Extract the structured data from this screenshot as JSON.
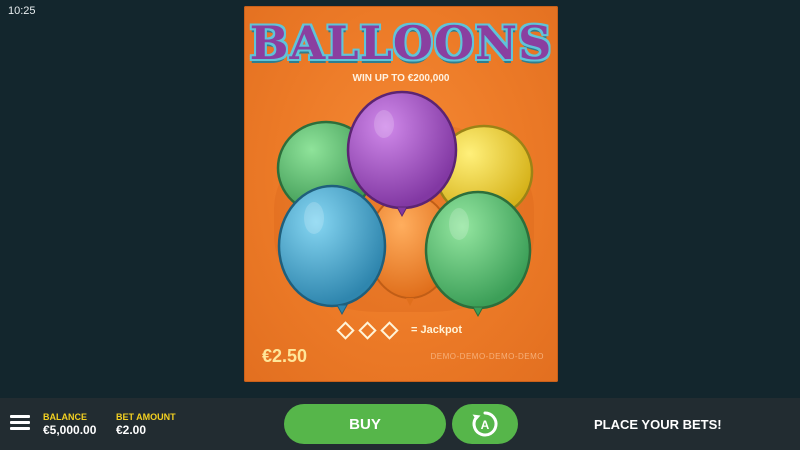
{
  "status_bar": {
    "time": "10:25"
  },
  "ticket": {
    "title": "BALLOONS",
    "subtitle": "WIN UP TO €200,000",
    "jackpot_label": "= Jackpot",
    "price": "€2.50",
    "demo_watermark": "DEMO-DEMO-DEMO-DEMO",
    "balloon_colors": {
      "green": "#5cc06a",
      "purple": "#a552c4",
      "yellow": "#f0d52c",
      "blue": "#42a7cf",
      "orange": "#f1872e"
    }
  },
  "bottom_bar": {
    "balance_label": "BALANCE",
    "balance_value": "€5,000.00",
    "bet_label": "BET AMOUNT",
    "bet_value": "€2.00",
    "buy_label": "BUY",
    "auto_icon": "autoplay-icon",
    "status_message": "PLACE YOUR BETS!"
  },
  "colors": {
    "background": "#13262d",
    "ticket": "#ec7a27",
    "button": "#56b64a",
    "label_accent": "#f3d021"
  }
}
